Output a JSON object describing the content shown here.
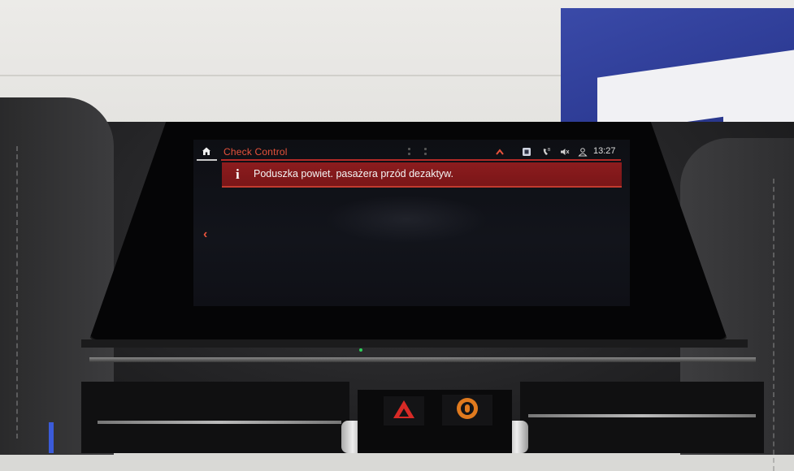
{
  "screen": {
    "status_bar": {
      "title": "Check Control",
      "time": "13:27",
      "icons": [
        "home-icon",
        "chevron-up-icon",
        "media-icon",
        "phone-signal-icon",
        "mute-icon",
        "user-profile-icon"
      ]
    },
    "notification": {
      "icon": "info-icon",
      "icon_glyph": "i",
      "message": "Poduszka powiet. pasażera przód dezaktyw."
    },
    "back_glyph": "‹"
  },
  "colors": {
    "accent": "#e8533c",
    "notification_bg": "#8c1c1e",
    "screen_bg": "#0e0f14",
    "hazard": "#d82a26",
    "airbag_indicator": "#e07a1e"
  }
}
